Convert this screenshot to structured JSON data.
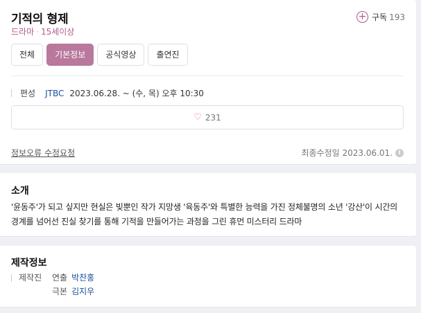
{
  "header": {
    "title": "기적의 형제",
    "genre": "드라마",
    "rating": "15세이상",
    "subscribe_label": "구독",
    "subscribe_count": "193"
  },
  "tabs": [
    {
      "label": "전체",
      "active": false
    },
    {
      "label": "기본정보",
      "active": true
    },
    {
      "label": "공식영상",
      "active": false
    },
    {
      "label": "출연진",
      "active": false
    }
  ],
  "broadcast": {
    "label": "편성",
    "station": "JTBC",
    "schedule": "2023.06.28. ~  (수, 목) 오후 10:30"
  },
  "like": {
    "count": "231"
  },
  "footer": {
    "report_link": "정보오류 수정요청",
    "updated": "최종수정일 2023.06.01."
  },
  "intro": {
    "title": "소개",
    "text": "'윤동주'가 되고 싶지만 현실은 빚뿐인 작가 지망생 '육동주'와 특별한 능력을 가진 정체불명의 소년 '강산'이 시간의 경계를 넘어선 진실 찾기를 통해 기적을 만들어가는 과정을 그린 휴먼 미스터리 드라마"
  },
  "production": {
    "title": "제작정보",
    "category": "제작진",
    "staff": [
      {
        "role": "연출",
        "name": "박찬홍"
      },
      {
        "role": "극본",
        "name": "김지우"
      }
    ]
  },
  "colors": {
    "accent": "#b9789c",
    "accent_text": "#b2598d",
    "link": "#1a4fa0"
  }
}
